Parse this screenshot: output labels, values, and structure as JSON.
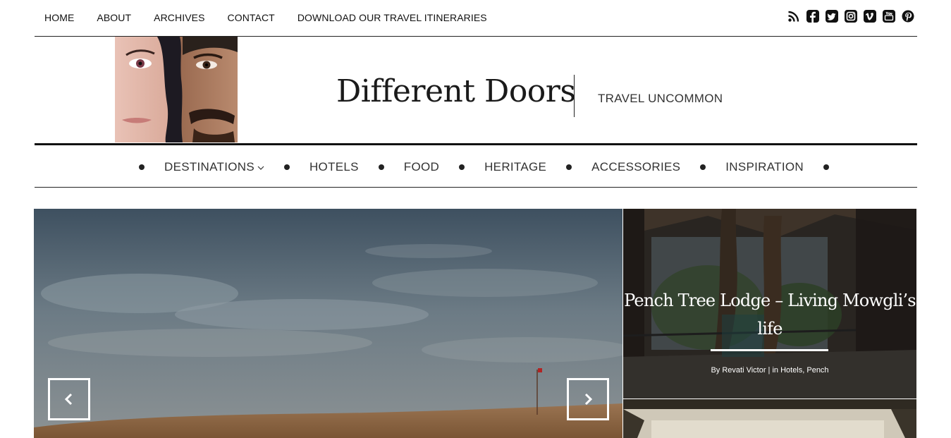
{
  "topnav": {
    "items": [
      "HOME",
      "ABOUT",
      "ARCHIVES",
      "CONTACT",
      "DOWNLOAD OUR TRAVEL ITINERARIES"
    ]
  },
  "socials": [
    "rss-icon",
    "facebook-icon",
    "twitter-icon",
    "instagram-icon",
    "vimeo-icon",
    "youtube-icon",
    "pinterest-icon"
  ],
  "header": {
    "title": "Different Doors",
    "tagline": "TRAVEL UNCOMMON"
  },
  "mainnav": {
    "items": [
      "DESTINATIONS",
      "HOTELS",
      "FOOD",
      "HERITAGE",
      "ACCESSORIES",
      "INSPIRATION"
    ]
  },
  "feature": {
    "title": "Pench Tree Lodge – Living Mowgli’s life",
    "meta": "By Revati Victor | in Hotels, Pench"
  },
  "colors": {
    "text": "#222222",
    "nav_text": "#333333",
    "accent_white": "#ffffff"
  }
}
